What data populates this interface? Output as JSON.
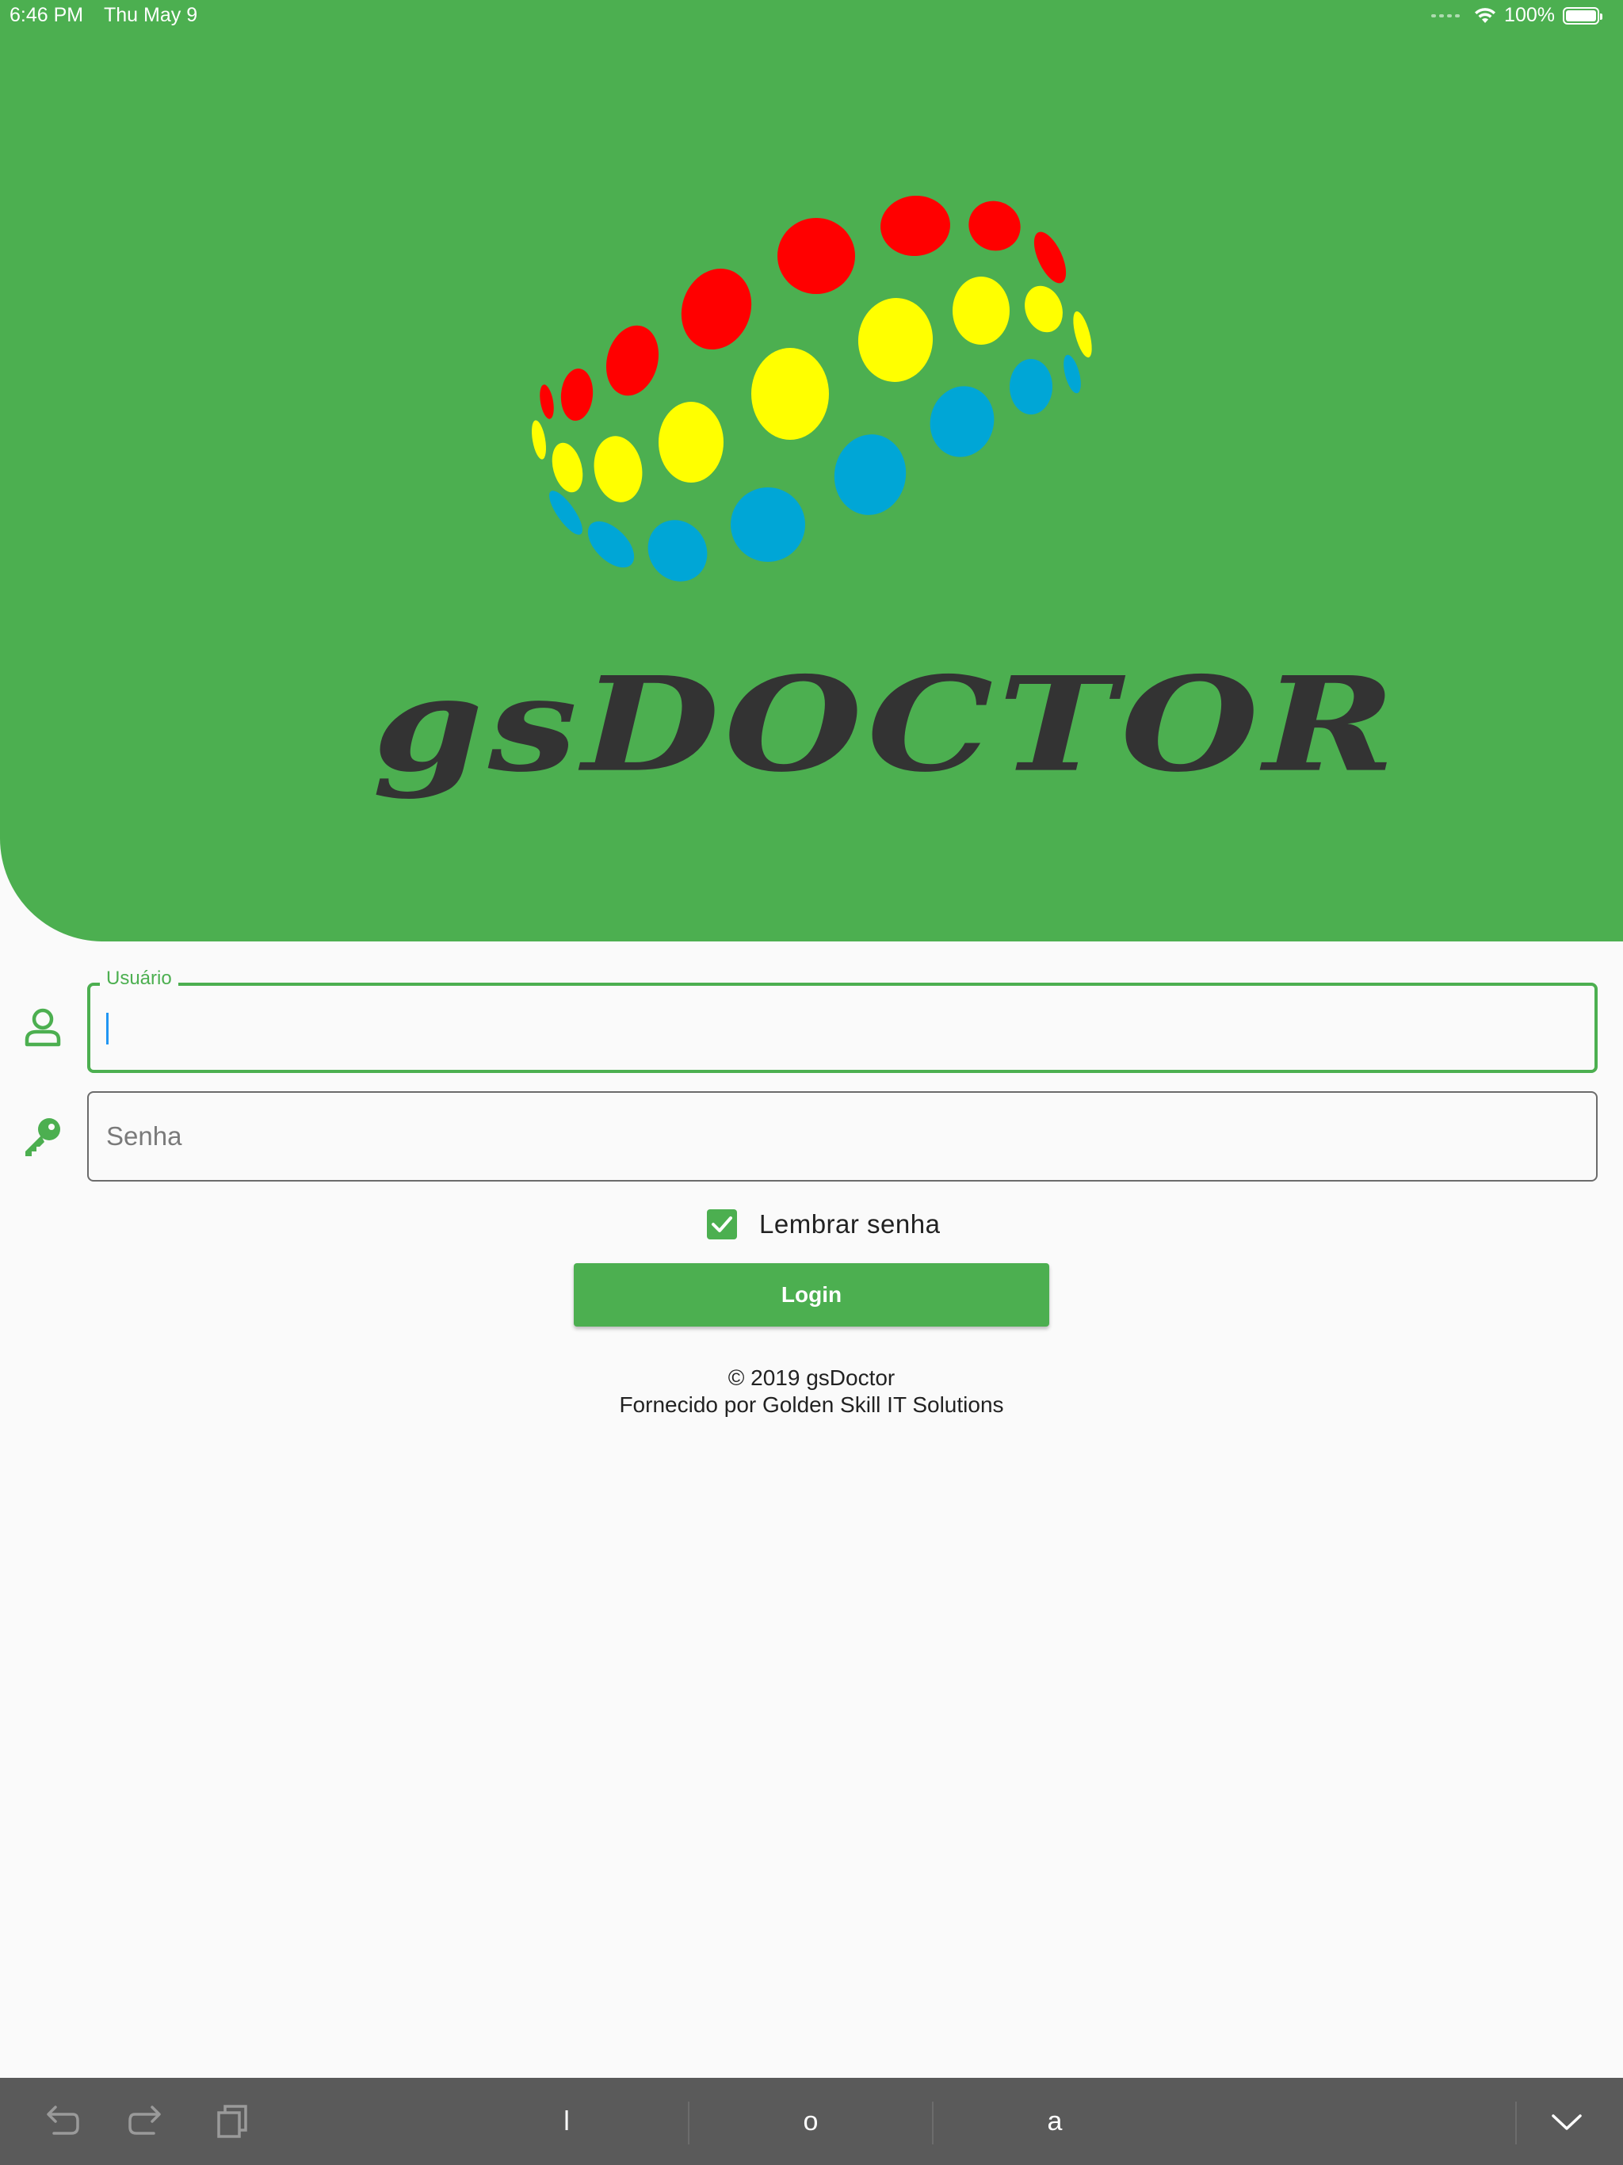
{
  "status_bar": {
    "time": "6:46 PM",
    "date": "Thu May 9",
    "battery": "100%"
  },
  "brand": {
    "name": "gsDOCTOR",
    "logo_icon": "dotted-sphere-logo",
    "dot_colors": [
      "#ff0000",
      "#ffff00",
      "#00a6d6"
    ]
  },
  "form": {
    "username": {
      "label": "Usuário",
      "value": "",
      "icon": "person-outline-icon"
    },
    "password": {
      "placeholder": "Senha",
      "value": "",
      "icon": "key-icon"
    },
    "remember": {
      "label": "Lembrar senha",
      "checked": true
    },
    "login_label": "Login"
  },
  "footer": {
    "copyright": "© 2019 gsDoctor",
    "provider": "Fornecido por Golden Skill IT Solutions"
  },
  "shortcut_bar": {
    "suggestions": [
      "l",
      "o",
      "a"
    ],
    "icons": [
      "undo-icon",
      "redo-icon",
      "paste-icon",
      "dismiss-keyboard-icon"
    ]
  },
  "colors": {
    "primary": "#4caf50",
    "text": "#333333",
    "background": "#fafafa",
    "keyboard_bar": "#5a5a5a"
  }
}
